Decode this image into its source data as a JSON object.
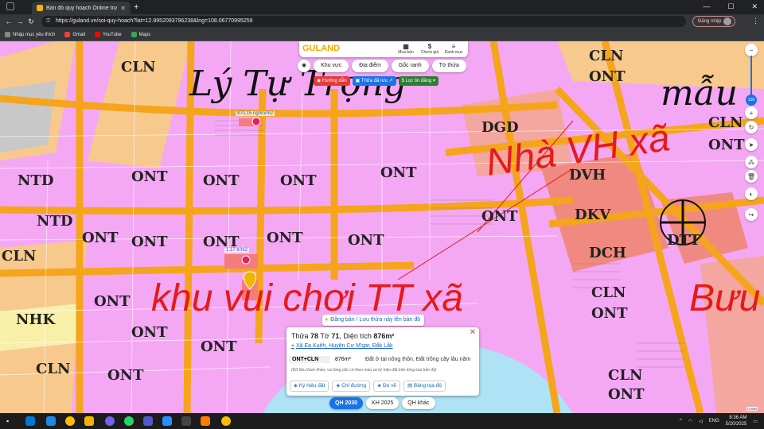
{
  "browser": {
    "tab_title": "Bản đồ quy hoạch Online trực tuy",
    "tab_close": "✕",
    "new_tab": "+",
    "url": "https://guland.vn/soi-quy-hoach?lat=12.9952093796238&lng=108.06770995259",
    "login_label": "Đăng nhập",
    "bookmarks": [
      "Nhập mục yêu thích",
      "Gmail",
      "YouTube",
      "Maps"
    ]
  },
  "panel": {
    "logo": "GULAND",
    "tools": [
      {
        "icon": "building-icon",
        "glyph": "▦",
        "label": "Mua bán"
      },
      {
        "icon": "dollar-icon",
        "glyph": "$",
        "label": "Check giá"
      },
      {
        "icon": "menu-icon",
        "glyph": "≡",
        "label": "Danh mục"
      }
    ]
  },
  "filters": [
    "Khu vực",
    "Địa điểm",
    "Gốc ranh",
    "Tờ thửa"
  ],
  "actions": [
    {
      "label": "◉ Hướng dẫn",
      "color": "#e53935"
    },
    {
      "label": "▣ Thửa đã lưu ↗",
      "color": "#1a73e8"
    },
    {
      "label": "$ Lọc tin đăng ▾",
      "color": "#2e7d32"
    }
  ],
  "map": {
    "zone_labels": [
      "CLN",
      "NTD",
      "NTD",
      "ONT",
      "ONT",
      "ONT",
      "ONT",
      "ONT",
      "ONT",
      "ONT",
      "ONT",
      "ONT",
      "ONT",
      "ONT",
      "ONT",
      "ONT",
      "CLN",
      "NHK",
      "CLN",
      "ONT",
      "CLN",
      "ONT",
      "DGD",
      "DVH",
      "DKV",
      "DCH",
      "DTT",
      "CLN",
      "ONT",
      "CLN",
      "ONT",
      "CLN",
      "ONT"
    ],
    "street_label": "Lý Tự Trọng",
    "street_label_right": "mẫu",
    "red_label": "khu vui chơi TT xã",
    "red_label_right": "Nhà VH xã",
    "red_label_far": "Bưu",
    "price_tags": [
      "870,15 nghìn/m2",
      "1,17 tr/m2"
    ],
    "zoom_level": "100"
  },
  "post_button": "Đăng bán / Lưu thửa này lên bản đồ",
  "info": {
    "title_prefix": "Thửa ",
    "parcel": "78",
    "title_mid": " Tờ ",
    "sheet": "71",
    "title_sep": ", Diện tích ",
    "area": "876m²",
    "location": "Xã Ea Kuêh, Huyện Cư M'gar, Đắk Lắk",
    "zone_code": "ONT+CLN",
    "zone_area": "876m²",
    "zone_desc": "Đất ở tại nông thôn, Đất trồng cây lâu năm",
    "note": "(Dữ liệu tham khảo, vui lòng căn cứ theo màu và ký hiệu đất trên từng loại bản đồ)",
    "buttons": [
      "◈ Ký hiệu đất",
      "◈ Chỉ đường",
      "◈ Đo vẽ",
      "▤ Bảng tọa độ"
    ]
  },
  "plan_tabs": [
    "QH 2030",
    "KH 2025",
    "QH khác"
  ],
  "leaflet": "Leaflet",
  "taskbar": {
    "lang": "ENG",
    "time": "8:36 AM",
    "date": "5/20/2025"
  }
}
